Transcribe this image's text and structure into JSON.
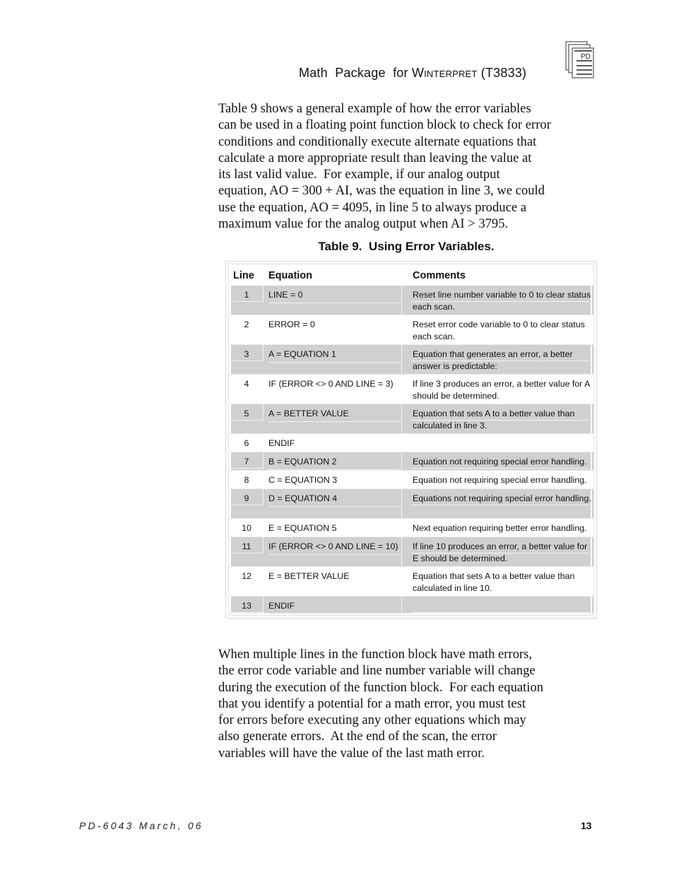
{
  "header": {
    "title_prefix": "Math  Package  for ",
    "title_product": "Winterpret",
    "title_suffix": " (T3833)",
    "logo_text": "PD"
  },
  "intro_paragraph": [
    "Table 9 shows a general example of how the error variables",
    "can be used in a floating point function block to check for error",
    "conditions and conditionally execute alternate equations that",
    "calculate a more appropriate result than leaving the value at",
    "its last valid value.  For example, if our analog output",
    "equation, AO = 300 + AI, was the equation in line 3, we could",
    "use the equation, AO = 4095, in line 5 to always produce a",
    "maximum value for the analog output when AI > 3795."
  ],
  "table": {
    "caption": "Table 9.  Using Error Variables.",
    "headers": {
      "line": "Line",
      "equation": "Equation",
      "comments": "Comments"
    },
    "rows": [
      {
        "line": "1",
        "equation": "LINE = 0",
        "comment": "Reset line number variable to 0 to clear status each scan.",
        "shaded": true
      },
      {
        "line": "2",
        "equation": "ERROR = 0",
        "comment": "Reset error code variable to 0 to clear status each scan.",
        "shaded": false
      },
      {
        "line": "3",
        "equation": "A = EQUATION 1",
        "comment": "Equation that generates an error, a better answer is predictable:",
        "shaded": true
      },
      {
        "line": "4",
        "equation": "IF (ERROR <> 0 AND LINE = 3)",
        "comment": "If line 3 produces an error, a better value for A should be determined.",
        "shaded": false
      },
      {
        "line": "5",
        "equation": "A = BETTER VALUE",
        "comment": "Equation that sets A to a better value than calculated in line 3.",
        "shaded": true
      },
      {
        "line": "6",
        "equation": "ENDIF",
        "comment": "",
        "shaded": false
      },
      {
        "line": "7",
        "equation": "B = EQUATION 2",
        "comment": "Equation not requiring special error handling.",
        "shaded": true
      },
      {
        "line": "8",
        "equation": "C = EQUATION 3",
        "comment": "Equation not requiring special error handling.",
        "shaded": false
      },
      {
        "line": "9",
        "equation": "D = EQUATION 4",
        "comment": "Equations not requiring special error handling.",
        "shaded": true
      },
      {
        "line": "10",
        "equation": "E = EQUATION 5",
        "comment": "Next equation requiring better error handling.",
        "shaded": false
      },
      {
        "line": "11",
        "equation": "IF (ERROR <> 0 AND LINE = 10)",
        "comment": "If line 10 produces an error, a better value for E should be determined.",
        "shaded": true
      },
      {
        "line": "12",
        "equation": "E = BETTER VALUE",
        "comment": "Equation that sets A to a better value than calculated in line 10.",
        "shaded": false
      },
      {
        "line": "13",
        "equation": "ENDIF",
        "comment": "",
        "shaded": true
      }
    ]
  },
  "closing_paragraph": [
    "When multiple lines in the function block have math errors,",
    "the error code variable and line number variable will change",
    "during the execution of the function block.  For each equation",
    "that you identify a potential for a math error, you must test",
    "for errors before executing any other equations which may",
    "also generate errors.  At the end of the scan, the error",
    "variables will have the value of the last math error."
  ],
  "footer": {
    "doc_id": "PD-6043 March, 06",
    "page_number": "13"
  }
}
